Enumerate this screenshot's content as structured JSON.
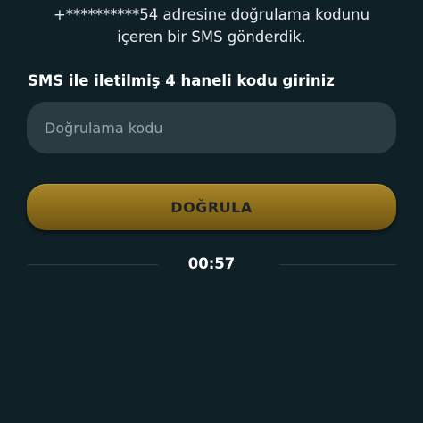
{
  "verification": {
    "info_text": "+**********54 adresine doğrulama kodunu\niçeren bir SMS gönderdik.",
    "label": "SMS ile iletilmiş 4 haneli kodu giriniz",
    "input": {
      "placeholder": "Doğrulama kodu",
      "value": ""
    },
    "verify_button_label": "DOĞRULA",
    "timer": "00:57"
  },
  "colors": {
    "background": "#0f2027",
    "input_background": "#2a3b42",
    "button_gold": "#9a7a22"
  }
}
